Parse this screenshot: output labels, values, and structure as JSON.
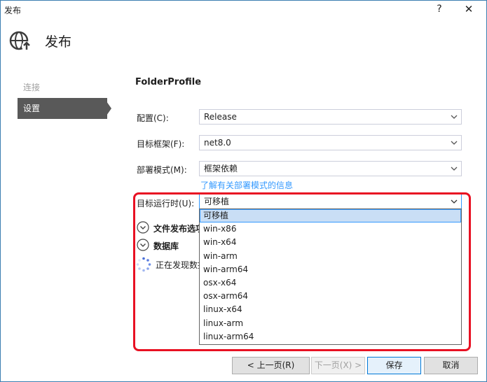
{
  "window": {
    "title": "发布",
    "help_label": "?",
    "close_label": "✕"
  },
  "header": {
    "title": "发布",
    "icon": "globe-publish-icon"
  },
  "nav": {
    "items": [
      {
        "label": "连接",
        "state": "disabled"
      },
      {
        "label": "设置",
        "state": "selected"
      }
    ]
  },
  "profile": {
    "name": "FolderProfile"
  },
  "form": {
    "configuration": {
      "label": "配置(C):",
      "value": "Release"
    },
    "target_framework": {
      "label": "目标框架(F):",
      "value": "net8.0"
    },
    "deployment_mode": {
      "label": "部署模式(M):",
      "value": "框架依赖"
    },
    "deployment_link": "了解有关部署模式的信息",
    "target_runtime": {
      "label": "目标运行时(U):",
      "value": "可移植",
      "options": [
        "可移植",
        "win-x86",
        "win-x64",
        "win-arm",
        "win-arm64",
        "osx-x64",
        "osx-arm64",
        "linux-x64",
        "linux-arm",
        "linux-arm64"
      ],
      "selected_index": 0
    }
  },
  "sections": {
    "file_publish_options": "文件发布选项",
    "database": "数据库",
    "discovering_status": "正在发现数据"
  },
  "buttons": {
    "prev": "< 上一页(R)",
    "next": "下一页(X) >",
    "save": "保存",
    "cancel": "取消"
  },
  "colors": {
    "accent": "#3399ff",
    "highlight_border": "#e81123",
    "nav_selected": "#595959",
    "selected_item_bg": "#c9def5"
  }
}
